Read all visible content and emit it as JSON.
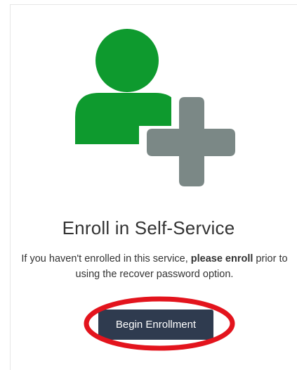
{
  "enroll": {
    "title": "Enroll in Self-Service",
    "description_start": "If you haven't enrolled in this service, ",
    "description_bold": "please enroll",
    "description_end": " prior to using the recover password option.",
    "button_label": "Begin Enrollment"
  },
  "icon": {
    "name": "add-user-icon",
    "person_color": "#0e9a2e",
    "plus_color": "#7b8886"
  },
  "colors": {
    "button_bg": "#2f3b4f",
    "highlight_ring": "#e3141d"
  }
}
